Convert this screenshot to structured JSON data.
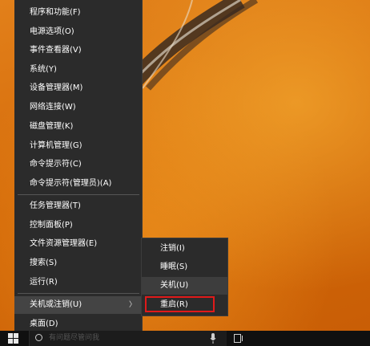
{
  "menu": {
    "group1": [
      "程序和功能(F)",
      "电源选项(O)",
      "事件查看器(V)",
      "系统(Y)",
      "设备管理器(M)",
      "网络连接(W)",
      "磁盘管理(K)",
      "计算机管理(G)",
      "命令提示符(C)",
      "命令提示符(管理员)(A)"
    ],
    "group2": [
      "任务管理器(T)",
      "控制面板(P)",
      "文件资源管理器(E)",
      "搜索(S)",
      "运行(R)"
    ],
    "group3": {
      "shutdown_label": "关机或注销(U)",
      "desktop_label": "桌面(D)"
    }
  },
  "submenu": {
    "items": [
      "注销(I)",
      "睡眠(S)",
      "关机(U)",
      "重启(R)"
    ],
    "highlight_color": "#e01a1a"
  },
  "taskbar": {
    "search_placeholder": "有问题尽管问我"
  },
  "icons": [
    "start-icon",
    "cortana-circle-icon",
    "microphone-icon",
    "task-view-icon",
    "chevron-right-icon"
  ]
}
